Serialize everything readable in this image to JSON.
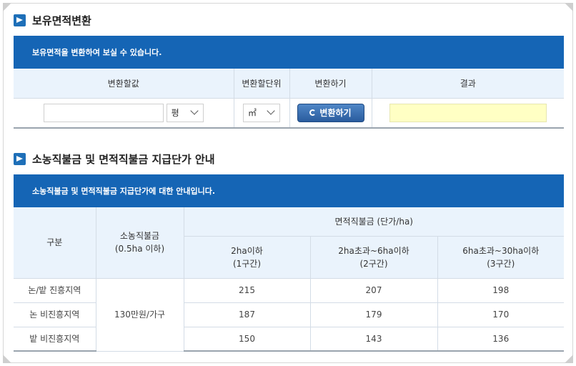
{
  "section1": {
    "title": "보유면적변환",
    "banner": "보유면적을 변환하여 보실 수 있습니다.",
    "headers": [
      "변환할값",
      "변환할단위",
      "변환하기",
      "결과"
    ],
    "input_value": "",
    "unit_from": "평",
    "unit_to": "㎡",
    "button_label": "변환하기",
    "result_value": ""
  },
  "section2": {
    "title": "소농직불금 및 면적직불금 지급단가 안내",
    "banner": "소농직불금 및 면적직불금 지급단가에 대한 안내입니다.",
    "headers": {
      "gubun": "구분",
      "small_farm_1": "소농직불금",
      "small_farm_2": "(0.5ha 이하)",
      "area_payment": "면적직불금 (단가/ha)",
      "tier1_1": "2ha이하",
      "tier1_2": "(1구간)",
      "tier2_1": "2ha초과~6ha이하",
      "tier2_2": "(2구간)",
      "tier3_1": "6ha초과~30ha이하",
      "tier3_2": "(3구간)"
    },
    "small_farm_amount": "130만원/가구",
    "rows": [
      {
        "region": "논/밭 진흥지역",
        "t1": "215",
        "t2": "207",
        "t3": "198"
      },
      {
        "region": "논 비진흥지역",
        "t1": "187",
        "t2": "179",
        "t3": "170"
      },
      {
        "region": "밭 비진흥지역",
        "t1": "150",
        "t2": "143",
        "t3": "136"
      }
    ]
  }
}
